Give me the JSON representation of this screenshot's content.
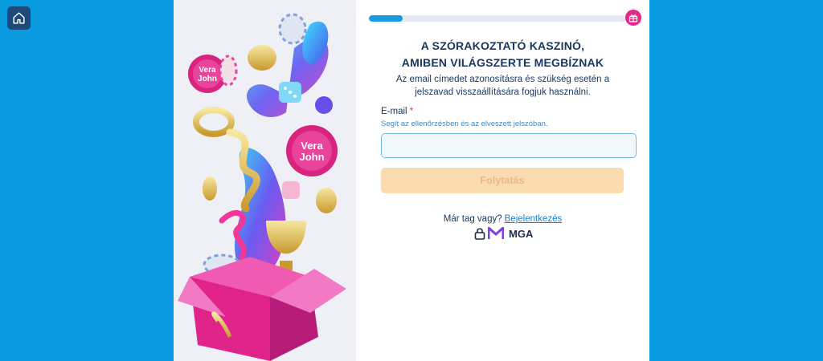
{
  "home": {
    "icon": "home-icon"
  },
  "progress": {
    "percent": 13
  },
  "header": {
    "gift_icon": "gift-icon"
  },
  "title": {
    "line1": "A SZÓRAKOZTATÓ KASZINÓ,",
    "line2": "AMIBEN VILÁGSZERTE MEGBÍZNAK"
  },
  "subtitle": "Az email címedet azonosításra és szükség esetén a jelszavad visszaállítására fogjuk használni.",
  "form": {
    "email_label": "E-mail",
    "required_mark": "*",
    "email_hint": "Segít az ellenőrzésben és az elveszett jelszóban.",
    "email_value": "",
    "submit_label": "Folytatás"
  },
  "login": {
    "prompt": "Már tag vagy?",
    "link": "Bejelentkezés"
  },
  "footer": {
    "lock_icon": "lock-icon",
    "mga_label": "MGA"
  },
  "art": {
    "chip_text_1": "Vera",
    "chip_text_2": "John"
  },
  "colors": {
    "background": "#0a9ae0",
    "accent": "#1a9be0",
    "brand_pink": "#e8268a",
    "button_disabled": "#fbdcb0",
    "title": "#17375e"
  }
}
